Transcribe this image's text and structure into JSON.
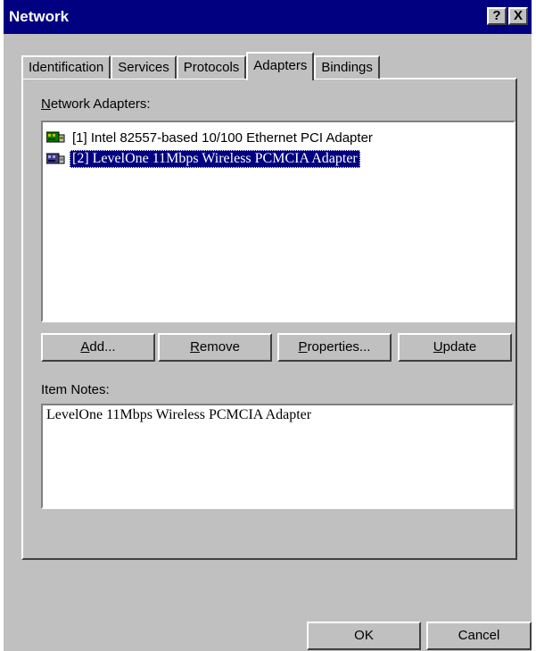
{
  "window": {
    "title": "Network",
    "help_glyph": "?",
    "close_glyph": "X"
  },
  "tabs": [
    {
      "label": "Identification"
    },
    {
      "label": "Services"
    },
    {
      "label": "Protocols"
    },
    {
      "label": "Adapters",
      "active": true
    },
    {
      "label": "Bindings"
    }
  ],
  "adapters": {
    "label_mnemonic": "N",
    "label_rest": "etwork Adapters:",
    "items": [
      {
        "text": "[1] Intel 82557-based 10/100 Ethernet PCI Adapter",
        "selected": false
      },
      {
        "text": "[2] LevelOne 11Mbps Wireless PCMCIA Adapter",
        "selected": true
      }
    ]
  },
  "actions": {
    "add_mnemonic": "A",
    "add_rest": "dd...",
    "remove_mnemonic": "R",
    "remove_rest": "emove",
    "properties_mnemonic": "P",
    "properties_rest": "roperties...",
    "update_mnemonic": "U",
    "update_rest": "pdate"
  },
  "notes": {
    "label": "Item Notes:",
    "text": "LevelOne 11Mbps Wireless PCMCIA Adapter"
  },
  "footer": {
    "ok": "OK",
    "cancel": "Cancel"
  },
  "colors": {
    "title_bar": "#000080",
    "face": "#c0c0c0",
    "selection": "#000080"
  },
  "icons": [
    "network-adapter-icon",
    "help-icon",
    "close-icon"
  ]
}
